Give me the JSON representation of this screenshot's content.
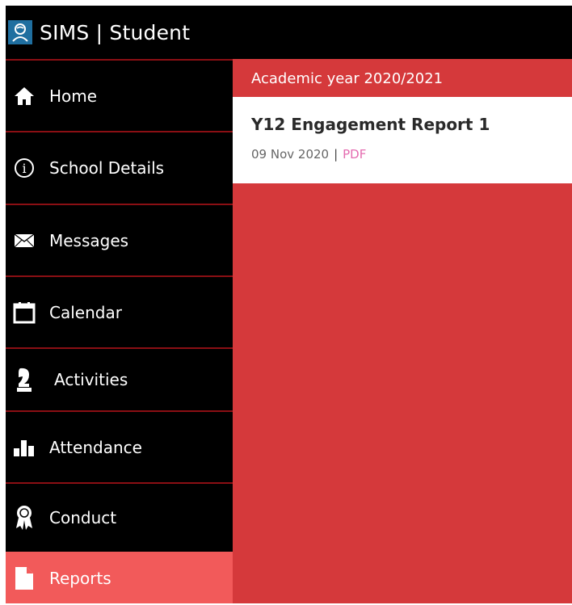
{
  "app": {
    "title": "SIMS | Student",
    "logo_icon": "student-avatar-icon",
    "accent": "#1f6fa0"
  },
  "sidebar": {
    "items": [
      {
        "label": "Home",
        "icon": "home-icon",
        "active": false
      },
      {
        "label": "School Details",
        "icon": "info-icon",
        "active": false
      },
      {
        "label": "Messages",
        "icon": "envelope-icon",
        "active": false
      },
      {
        "label": "Calendar",
        "icon": "calendar-icon",
        "active": false
      },
      {
        "label": "Activities",
        "icon": "chess-knight-icon",
        "active": false
      },
      {
        "label": "Attendance",
        "icon": "bar-chart-icon",
        "active": false
      },
      {
        "label": "Conduct",
        "icon": "award-icon",
        "active": false
      },
      {
        "label": "Reports",
        "icon": "document-icon",
        "active": true
      }
    ]
  },
  "reports": {
    "year_header": "Academic year 2020/2021",
    "items": [
      {
        "title": "Y12 Engagement Report 1",
        "date": "09 Nov 2020",
        "separator": "|",
        "link": "PDF"
      }
    ]
  },
  "colors": {
    "content_bg": "#d5393b",
    "active_item": "#f25a5a",
    "divider": "#8b0f14",
    "pdf_link": "#e46bb0"
  }
}
